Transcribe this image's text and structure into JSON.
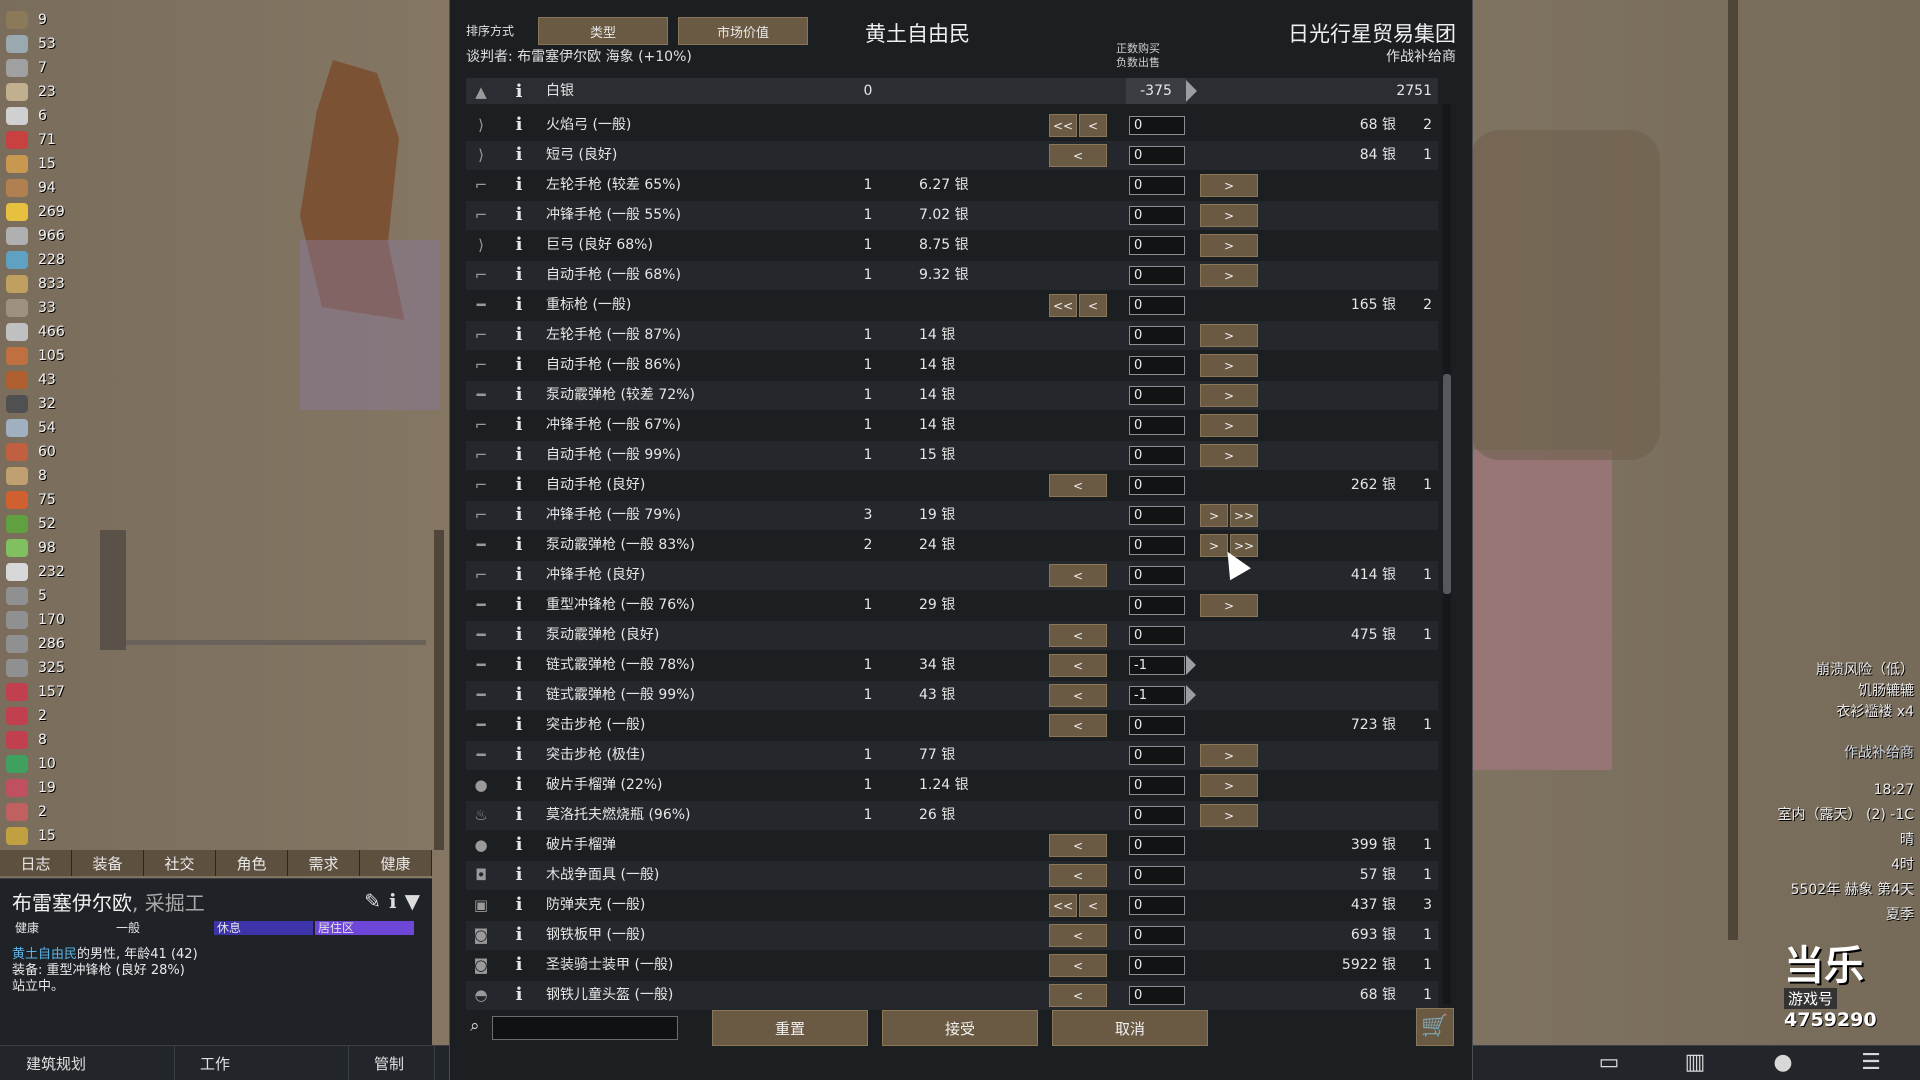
{
  "resources": [
    "9",
    "53",
    "7",
    "23",
    "6",
    "71",
    "15",
    "94",
    "269",
    "966",
    "228",
    "833",
    "33",
    "466",
    "105",
    "43",
    "32",
    "54",
    "60",
    "8",
    "75",
    "52",
    "98",
    "232",
    "5",
    "170",
    "286",
    "325",
    "157",
    "2",
    "8",
    "10",
    "19",
    "2",
    "15"
  ],
  "resource_colors": [
    "#8a7a5a",
    "#9aa8b0",
    "#a0a0a0",
    "#c0b090",
    "#d0d0d0",
    "#c84040",
    "#c89850",
    "#b08050",
    "#e8c040",
    "#b0b0b0",
    "#60a0c0",
    "#c0a060",
    "#a09080",
    "#c0c0c0",
    "#c07040",
    "#b06030",
    "#505050",
    "#a0b0c0",
    "#c06040",
    "#c0a070",
    "#d06030",
    "#60a040",
    "#80c060",
    "#d8d8d8",
    "#909090",
    "#909090",
    "#909090",
    "#909090",
    "#c04050",
    "#c04050",
    "#c04050",
    "#40a060",
    "#c05060",
    "#c06060",
    "#c0a040"
  ],
  "char_tabs": [
    "日志",
    "装备",
    "社交",
    "角色",
    "需求",
    "健康"
  ],
  "colonist": {
    "name": "布雷塞伊尔欧",
    "job": ", 采掘工",
    "bars": [
      {
        "label": "健康",
        "color": "#1f2327"
      },
      {
        "label": "一般",
        "color": "#1f2327"
      },
      {
        "label": "休息",
        "color": "#3c34a8"
      },
      {
        "label": "居住区",
        "color": "#6e46d8"
      }
    ],
    "faction": "黄土自由民",
    "desc": "的男性, 年龄41 (42)",
    "equip": "装备: 重型冲锋枪 (良好 28%)",
    "status": "站立中。"
  },
  "bottom_buttons": [
    "建筑规划",
    "工作",
    "管制"
  ],
  "right_info": {
    "alerts": [
      "崩溃风险（低）",
      "饥肠辘辘",
      "衣衫褴褛 x4"
    ],
    "trader_tag": "作战补给商",
    "time": "18:27",
    "temp": "室内（露天） (2) -1C",
    "weather": "晴",
    "hour": "4时",
    "date": "5502年 赫象 第4天",
    "season": "夏季",
    "logo_text": "当乐",
    "logo_sub": "游戏号",
    "logo_num": "4759290"
  },
  "dialog": {
    "sort_label": "排序方式",
    "sort_buttons": [
      "类型",
      "市场价值"
    ],
    "title_left": "黄土自由民",
    "title_right": "日光行星贸易集团",
    "subtitle_right": "作战补给商",
    "negotiator": "谈判者: 布雷塞伊尔欧 海象 (+10%)",
    "col_header_1": "正数购买",
    "col_header_2": "负数出售",
    "silver": {
      "name": "白银",
      "left": "0",
      "qty": "-375",
      "right": "2751"
    },
    "rows": [
      {
        "icon": "bow",
        "name": "火焰弓 (一般)",
        "cnt": "",
        "price": "",
        "left_btns": [
          "<<",
          "<"
        ],
        "qty": "0",
        "arrow": false,
        "right_btns": [],
        "tprice": "68 银",
        "tcnt": "2"
      },
      {
        "icon": "bow",
        "name": "短弓 (良好)",
        "cnt": "",
        "price": "",
        "left_btns": [
          "<"
        ],
        "qty": "0",
        "arrow": false,
        "right_btns": [],
        "tprice": "84 银",
        "tcnt": "1"
      },
      {
        "icon": "gun",
        "name": "左轮手枪 (较差 65%)",
        "cnt": "1",
        "price": "6.27 银",
        "left_btns": [],
        "qty": "0",
        "arrow": false,
        "right_btns": [
          ">"
        ],
        "tprice": "",
        "tcnt": ""
      },
      {
        "icon": "gun",
        "name": "冲锋手枪 (一般 55%)",
        "cnt": "1",
        "price": "7.02 银",
        "left_btns": [],
        "qty": "0",
        "arrow": false,
        "right_btns": [
          ">"
        ],
        "tprice": "",
        "tcnt": ""
      },
      {
        "icon": "bow",
        "name": "巨弓 (良好 68%)",
        "cnt": "1",
        "price": "8.75 银",
        "left_btns": [],
        "qty": "0",
        "arrow": false,
        "right_btns": [
          ">"
        ],
        "tprice": "",
        "tcnt": ""
      },
      {
        "icon": "gun",
        "name": "自动手枪 (一般 68%)",
        "cnt": "1",
        "price": "9.32 银",
        "left_btns": [],
        "qty": "0",
        "arrow": false,
        "right_btns": [
          ">"
        ],
        "tprice": "",
        "tcnt": ""
      },
      {
        "icon": "rifle",
        "name": "重标枪 (一般)",
        "cnt": "",
        "price": "",
        "left_btns": [
          "<<",
          "<"
        ],
        "qty": "0",
        "arrow": false,
        "right_btns": [],
        "tprice": "165 银",
        "tcnt": "2"
      },
      {
        "icon": "gun",
        "name": "左轮手枪 (一般 87%)",
        "cnt": "1",
        "price": "14 银",
        "left_btns": [],
        "qty": "0",
        "arrow": false,
        "right_btns": [
          ">"
        ],
        "tprice": "",
        "tcnt": ""
      },
      {
        "icon": "gun",
        "name": "自动手枪 (一般 86%)",
        "cnt": "1",
        "price": "14 银",
        "left_btns": [],
        "qty": "0",
        "arrow": false,
        "right_btns": [
          ">"
        ],
        "tprice": "",
        "tcnt": ""
      },
      {
        "icon": "rifle",
        "name": "泵动霰弹枪 (较差 72%)",
        "cnt": "1",
        "price": "14 银",
        "left_btns": [],
        "qty": "0",
        "arrow": false,
        "right_btns": [
          ">"
        ],
        "tprice": "",
        "tcnt": ""
      },
      {
        "icon": "gun",
        "name": "冲锋手枪 (一般 67%)",
        "cnt": "1",
        "price": "14 银",
        "left_btns": [],
        "qty": "0",
        "arrow": false,
        "right_btns": [
          ">"
        ],
        "tprice": "",
        "tcnt": ""
      },
      {
        "icon": "gun",
        "name": "自动手枪 (一般 99%)",
        "cnt": "1",
        "price": "15 银",
        "left_btns": [],
        "qty": "0",
        "arrow": false,
        "right_btns": [
          ">"
        ],
        "tprice": "",
        "tcnt": ""
      },
      {
        "icon": "gun",
        "name": "自动手枪 (良好)",
        "cnt": "",
        "price": "",
        "left_btns": [
          "<"
        ],
        "qty": "0",
        "arrow": false,
        "right_btns": [],
        "tprice": "262 银",
        "tcnt": "1"
      },
      {
        "icon": "gun",
        "name": "冲锋手枪 (一般 79%)",
        "cnt": "3",
        "price": "19 银",
        "left_btns": [],
        "qty": "0",
        "arrow": false,
        "right_btns": [
          ">",
          ">>"
        ],
        "tprice": "",
        "tcnt": ""
      },
      {
        "icon": "rifle",
        "name": "泵动霰弹枪 (一般 83%)",
        "cnt": "2",
        "price": "24 银",
        "left_btns": [],
        "qty": "0",
        "arrow": false,
        "right_btns": [
          ">",
          ">>"
        ],
        "tprice": "",
        "tcnt": ""
      },
      {
        "icon": "gun",
        "name": "冲锋手枪 (良好)",
        "cnt": "",
        "price": "",
        "left_btns": [
          "<"
        ],
        "qty": "0",
        "arrow": false,
        "right_btns": [],
        "tprice": "414 银",
        "tcnt": "1"
      },
      {
        "icon": "rifle",
        "name": "重型冲锋枪 (一般 76%)",
        "cnt": "1",
        "price": "29 银",
        "left_btns": [],
        "qty": "0",
        "arrow": false,
        "right_btns": [
          ">"
        ],
        "tprice": "",
        "tcnt": ""
      },
      {
        "icon": "rifle",
        "name": "泵动霰弹枪 (良好)",
        "cnt": "",
        "price": "",
        "left_btns": [
          "<"
        ],
        "qty": "0",
        "arrow": false,
        "right_btns": [],
        "tprice": "475 银",
        "tcnt": "1"
      },
      {
        "icon": "rifle",
        "name": "链式霰弹枪 (一般 78%)",
        "cnt": "1",
        "price": "34 银",
        "left_btns": [
          "<"
        ],
        "qty": "-1",
        "arrow": true,
        "right_btns": [],
        "tprice": "",
        "tcnt": ""
      },
      {
        "icon": "rifle",
        "name": "链式霰弹枪 (一般 99%)",
        "cnt": "1",
        "price": "43 银",
        "left_btns": [
          "<"
        ],
        "qty": "-1",
        "arrow": true,
        "right_btns": [],
        "tprice": "",
        "tcnt": ""
      },
      {
        "icon": "rifle",
        "name": "突击步枪 (一般)",
        "cnt": "",
        "price": "",
        "left_btns": [
          "<"
        ],
        "qty": "0",
        "arrow": false,
        "right_btns": [],
        "tprice": "723 银",
        "tcnt": "1"
      },
      {
        "icon": "rifle",
        "name": "突击步枪 (极佳)",
        "cnt": "1",
        "price": "77 银",
        "left_btns": [],
        "qty": "0",
        "arrow": false,
        "right_btns": [
          ">"
        ],
        "tprice": "",
        "tcnt": ""
      },
      {
        "icon": "grenade",
        "name": "破片手榴弹 (22%)",
        "cnt": "1",
        "price": "1.24 银",
        "left_btns": [],
        "qty": "0",
        "arrow": false,
        "right_btns": [
          ">"
        ],
        "tprice": "",
        "tcnt": ""
      },
      {
        "icon": "molotov",
        "name": "莫洛托夫燃烧瓶 (96%)",
        "cnt": "1",
        "price": "26 银",
        "left_btns": [],
        "qty": "0",
        "arrow": false,
        "right_btns": [
          ">"
        ],
        "tprice": "",
        "tcnt": ""
      },
      {
        "icon": "grenade",
        "name": "破片手榴弹",
        "cnt": "",
        "price": "",
        "left_btns": [
          "<"
        ],
        "qty": "0",
        "arrow": false,
        "right_btns": [],
        "tprice": "399 银",
        "tcnt": "1"
      },
      {
        "icon": "mask",
        "name": "木战争面具 (一般)",
        "cnt": "",
        "price": "",
        "left_btns": [
          "<"
        ],
        "qty": "0",
        "arrow": false,
        "right_btns": [],
        "tprice": "57 银",
        "tcnt": "1"
      },
      {
        "icon": "vest",
        "name": "防弹夹克 (一般)",
        "cnt": "",
        "price": "",
        "left_btns": [
          "<<",
          "<"
        ],
        "qty": "0",
        "arrow": false,
        "right_btns": [],
        "tprice": "437 银",
        "tcnt": "3"
      },
      {
        "icon": "armor",
        "name": "钢铁板甲 (一般)",
        "cnt": "",
        "price": "",
        "left_btns": [
          "<"
        ],
        "qty": "0",
        "arrow": false,
        "right_btns": [],
        "tprice": "693 银",
        "tcnt": "1"
      },
      {
        "icon": "armor",
        "name": "圣装骑士装甲 (一般)",
        "cnt": "",
        "price": "",
        "left_btns": [
          "<"
        ],
        "qty": "0",
        "arrow": false,
        "right_btns": [],
        "tprice": "5922 银",
        "tcnt": "1"
      },
      {
        "icon": "helmet",
        "name": "钢铁儿童头盔 (一般)",
        "cnt": "",
        "price": "",
        "left_btns": [
          "<"
        ],
        "qty": "0",
        "arrow": false,
        "right_btns": [],
        "tprice": "68 银",
        "tcnt": "1"
      }
    ],
    "buttons": {
      "reset": "重置",
      "accept": "接受",
      "cancel": "取消"
    }
  }
}
